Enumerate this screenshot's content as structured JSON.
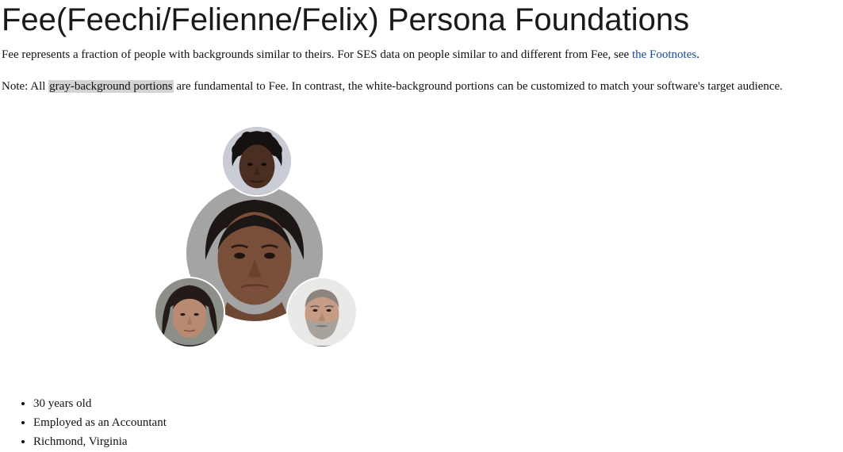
{
  "header": {
    "title": "Fee(Feechi/Felienne/Felix) Persona Foundations"
  },
  "intro": {
    "text_before": "Fee represents a fraction of people with backgrounds similar to theirs. For SES data on people similar to and different from Fee, see ",
    "link_label": "the Footnotes",
    "text_after": "."
  },
  "note": {
    "prefix": "Note: All ",
    "highlight": "gray-background portions",
    "suffix": " are fundamental to Fee. In contrast, the white-background portions can be customized to match your software's target audience."
  },
  "facts": [
    "30 years old",
    "Employed as an Accountant",
    "Richmond, Virginia"
  ],
  "colors": {
    "link": "#1a4b9b",
    "highlight_bg": "#d3d3d3"
  }
}
